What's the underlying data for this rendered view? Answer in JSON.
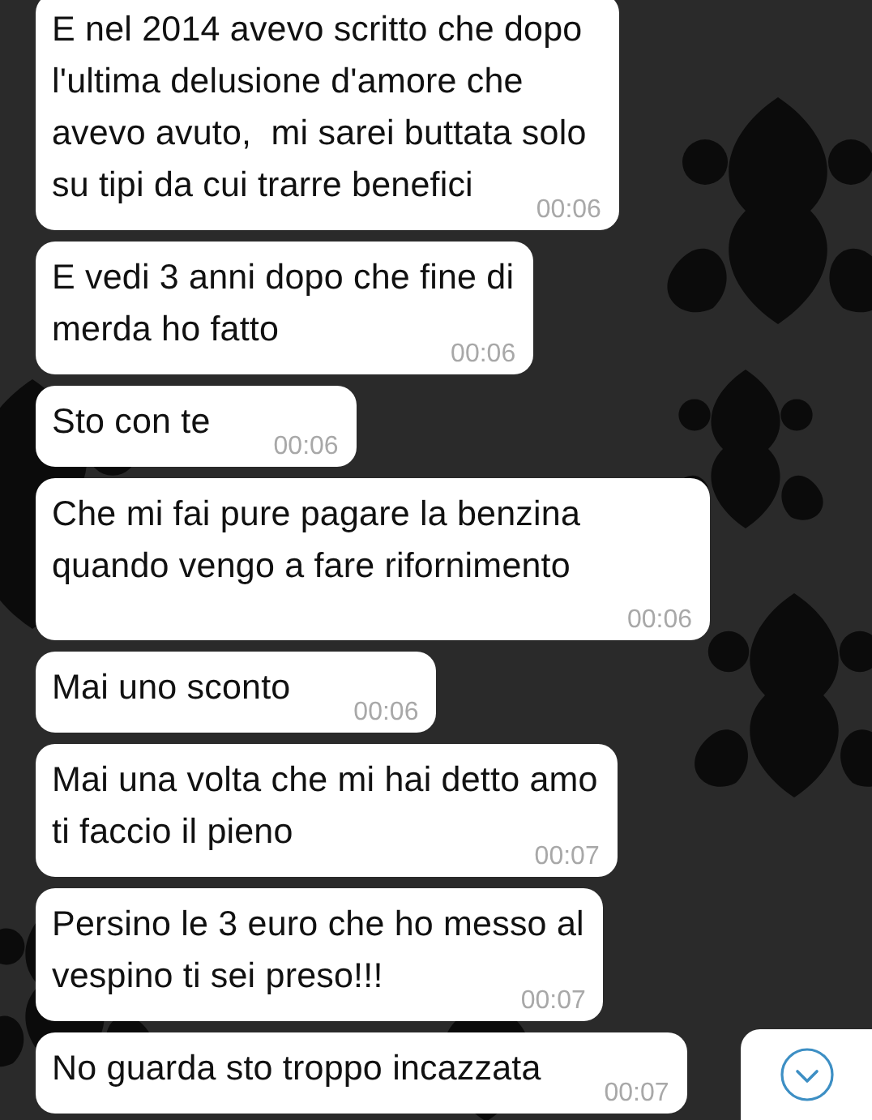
{
  "messages": [
    {
      "text": "E nel 2014 avevo scritto che dopo\nl'ultima delusione d'amore che\navevo avuto,  mi sarei buttata solo\nsu tipi da cui trarre benefici",
      "time": "00:06"
    },
    {
      "text": "E vedi 3 anni dopo che fine di\nmerda ho fatto",
      "time": "00:06"
    },
    {
      "text": "Sto con te",
      "time": "00:06"
    },
    {
      "text": "Che mi fai pure pagare la benzina\nquando vengo a fare rifornimento",
      "time": "00:06"
    },
    {
      "text": "Mai uno sconto",
      "time": "00:06"
    },
    {
      "text": "Mai una volta che mi hai detto amo\nti faccio il pieno",
      "time": "00:07"
    },
    {
      "text": "Persino le 3 euro che ho messo al\nvespino ti sei preso!!!",
      "time": "00:07"
    },
    {
      "text": "No guarda sto troppo incazzata",
      "time": "00:07"
    }
  ]
}
